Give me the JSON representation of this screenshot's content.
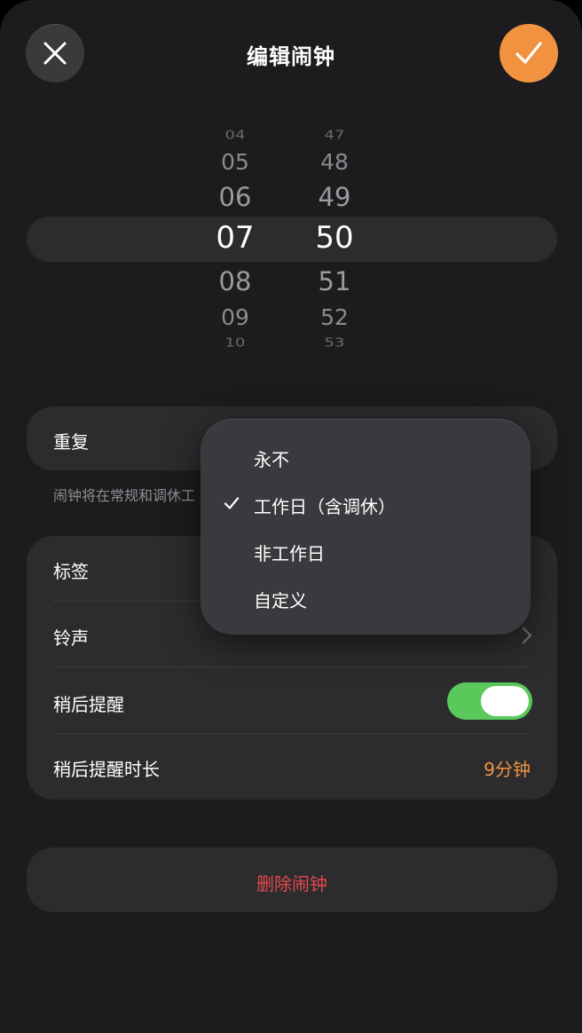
{
  "header": {
    "title": "编辑闹钟"
  },
  "picker": {
    "hours": [
      "04",
      "05",
      "06",
      "07",
      "08",
      "09",
      "10"
    ],
    "minutes": [
      "47",
      "48",
      "49",
      "50",
      "51",
      "52",
      "53"
    ],
    "selected_hour": "07",
    "selected_minute": "50"
  },
  "repeat": {
    "label": "重复",
    "hint": "闹钟将在常规和调休工"
  },
  "repeat_menu": {
    "options": [
      "永不",
      "工作日（含调休）",
      "非工作日",
      "自定义"
    ],
    "selected": "工作日（含调休）"
  },
  "options": {
    "label_row": "标签",
    "ringtone_row": "铃声",
    "snooze_row": "稍后提醒",
    "snooze_enabled": true,
    "snooze_duration_row": "稍后提醒时长",
    "snooze_duration_value": "9分钟"
  },
  "delete": {
    "label": "删除闹钟"
  },
  "colors": {
    "accent": "#f0923f",
    "toggle_on": "#5ac85a",
    "destructive": "#e5484d",
    "background": "#1c1c1e",
    "card": "#2c2c2e"
  },
  "icons": {
    "close": "close-icon",
    "confirm": "checkmark-icon",
    "chevron": "chevron-right-icon",
    "menu_check": "checkmark-icon"
  }
}
